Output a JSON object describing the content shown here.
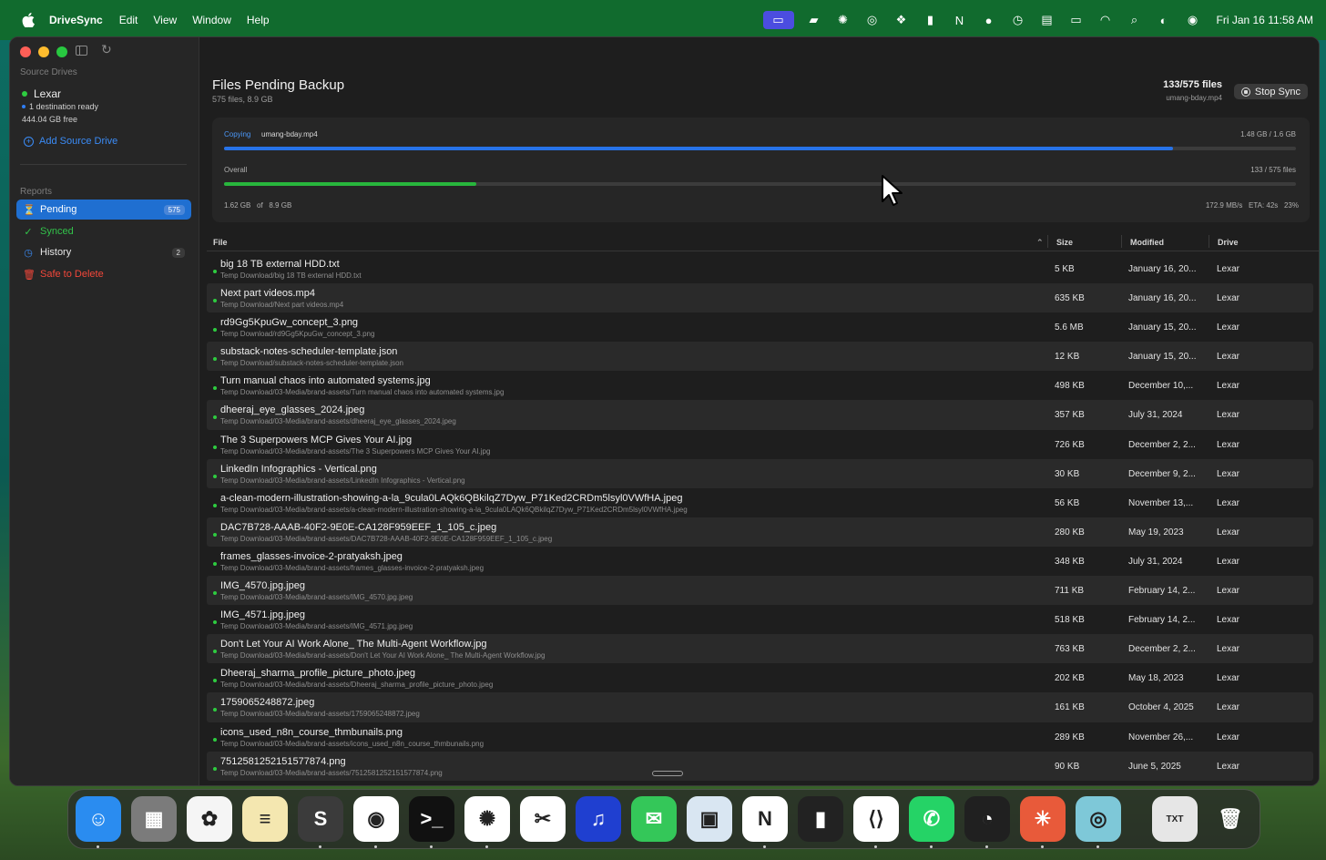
{
  "menubar": {
    "app_name": "DriveSync",
    "menus": [
      "Edit",
      "View",
      "Window",
      "Help"
    ],
    "status_icons": [
      "screen-share-icon",
      "car-icon",
      "sparkle-icon",
      "chatgpt-icon",
      "dropbox-icon",
      "bars-icon",
      "notion-icon",
      "vpn-icon",
      "time-machine-icon",
      "keyboard-icon",
      "battery-icon",
      "wifi-icon",
      "search-icon",
      "control-center-icon",
      "siri-icon"
    ],
    "clock": "Fri Jan 16  11:58 AM"
  },
  "sidebar": {
    "source_drives_heading": "Source Drives",
    "drive": {
      "name": "Lexar",
      "destination": "1 destination ready",
      "free": "444.04 GB free"
    },
    "add_source": "Add Source Drive",
    "reports_heading": "Reports",
    "items": [
      {
        "label": "Pending",
        "badge": "575",
        "icon": "pending-icon"
      },
      {
        "label": "Synced",
        "badge": "",
        "icon": "check-circle-icon"
      },
      {
        "label": "History",
        "badge": "2",
        "icon": "clock-icon"
      },
      {
        "label": "Safe to Delete",
        "badge": "",
        "icon": "trash-icon"
      }
    ]
  },
  "header": {
    "title": "Files Pending Backup",
    "subtitle": "575 files, 8.9 GB",
    "count": "133/575 files",
    "current_file": "umang-bday.mp4",
    "stop_label": "Stop Sync"
  },
  "progress": {
    "copying_label": "Copying",
    "copying_file": "umang-bday.mp4",
    "file_progress_text": "1.48 GB / 1.6 GB",
    "file_fraction": 0.885,
    "overall_label": "Overall",
    "overall_text": "133 / 575 files",
    "overall_fraction": 0.235,
    "copied": "1.62 GB",
    "of_label": "of",
    "total": "8.9 GB",
    "speed": "172.9 MB/s",
    "eta": "ETA: 42s",
    "percent": "23%"
  },
  "table": {
    "columns": {
      "file": "File",
      "size": "Size",
      "modified": "Modified",
      "drive": "Drive"
    },
    "rows": [
      {
        "name": "big 18 TB external HDD.txt",
        "path": "Temp Download/big 18 TB external HDD.txt",
        "size": "5 KB",
        "modified": "January 16, 20...",
        "drive": "Lexar"
      },
      {
        "name": "Next part videos.mp4",
        "path": "Temp Download/Next part videos.mp4",
        "size": "635 KB",
        "modified": "January 16, 20...",
        "drive": "Lexar"
      },
      {
        "name": "rd9Gg5KpuGw_concept_3.png",
        "path": "Temp Download/rd9Gg5KpuGw_concept_3.png",
        "size": "5.6 MB",
        "modified": "January 15, 20...",
        "drive": "Lexar"
      },
      {
        "name": "substack-notes-scheduler-template.json",
        "path": "Temp Download/substack-notes-scheduler-template.json",
        "size": "12 KB",
        "modified": "January 15, 20...",
        "drive": "Lexar"
      },
      {
        "name": "Turn manual chaos into automated systems.jpg",
        "path": "Temp Download/03-Media/brand-assets/Turn manual chaos into automated systems.jpg",
        "size": "498 KB",
        "modified": "December 10,...",
        "drive": "Lexar"
      },
      {
        "name": "dheeraj_eye_glasses_2024.jpeg",
        "path": "Temp Download/03-Media/brand-assets/dheeraj_eye_glasses_2024.jpeg",
        "size": "357 KB",
        "modified": "July 31, 2024",
        "drive": "Lexar"
      },
      {
        "name": "The 3 Superpowers MCP Gives Your AI.jpg",
        "path": "Temp Download/03-Media/brand-assets/The 3 Superpowers MCP Gives Your AI.jpg",
        "size": "726 KB",
        "modified": "December 2, 2...",
        "drive": "Lexar"
      },
      {
        "name": "LinkedIn Infographics - Vertical.png",
        "path": "Temp Download/03-Media/brand-assets/LinkedIn Infographics - Vertical.png",
        "size": "30 KB",
        "modified": "December 9, 2...",
        "drive": "Lexar"
      },
      {
        "name": "a-clean-modern-illustration-showing-a-la_9cula0LAQk6QBkilqZ7Dyw_P71Ked2CRDm5lsyl0VWfHA.jpeg",
        "path": "Temp Download/03-Media/brand-assets/a-clean-modern-illustration-showing-a-la_9cula0LAQk6QBkilqZ7Dyw_P71Ked2CRDm5lsyl0VWfHA.jpeg",
        "size": "56 KB",
        "modified": "November 13,...",
        "drive": "Lexar"
      },
      {
        "name": "DAC7B728-AAAB-40F2-9E0E-CA128F959EEF_1_105_c.jpeg",
        "path": "Temp Download/03-Media/brand-assets/DAC7B728-AAAB-40F2-9E0E-CA128F959EEF_1_105_c.jpeg",
        "size": "280 KB",
        "modified": "May 19, 2023",
        "drive": "Lexar"
      },
      {
        "name": "frames_glasses-invoice-2-pratyaksh.jpeg",
        "path": "Temp Download/03-Media/brand-assets/frames_glasses-invoice-2-pratyaksh.jpeg",
        "size": "348 KB",
        "modified": "July 31, 2024",
        "drive": "Lexar"
      },
      {
        "name": "IMG_4570.jpg.jpeg",
        "path": "Temp Download/03-Media/brand-assets/IMG_4570.jpg.jpeg",
        "size": "711 KB",
        "modified": "February 14, 2...",
        "drive": "Lexar"
      },
      {
        "name": "IMG_4571.jpg.jpeg",
        "path": "Temp Download/03-Media/brand-assets/IMG_4571.jpg.jpeg",
        "size": "518 KB",
        "modified": "February 14, 2...",
        "drive": "Lexar"
      },
      {
        "name": "Don't Let Your AI Work Alone_ The Multi-Agent Workflow.jpg",
        "path": "Temp Download/03-Media/brand-assets/Don't Let Your AI Work Alone_ The Multi-Agent Workflow.jpg",
        "size": "763 KB",
        "modified": "December 2, 2...",
        "drive": "Lexar"
      },
      {
        "name": "Dheeraj_sharma_profile_picture_photo.jpeg",
        "path": "Temp Download/03-Media/brand-assets/Dheeraj_sharma_profile_picture_photo.jpeg",
        "size": "202 KB",
        "modified": "May 18, 2023",
        "drive": "Lexar"
      },
      {
        "name": "1759065248872.jpeg",
        "path": "Temp Download/03-Media/brand-assets/1759065248872.jpeg",
        "size": "161 KB",
        "modified": "October 4, 2025",
        "drive": "Lexar"
      },
      {
        "name": "icons_used_n8n_course_thmbunails.png",
        "path": "Temp Download/03-Media/brand-assets/icons_used_n8n_course_thmbunails.png",
        "size": "289 KB",
        "modified": "November 26,...",
        "drive": "Lexar"
      },
      {
        "name": "7512581252151577874.png",
        "path": "Temp Download/03-Media/brand-assets/7512581252151577874.png",
        "size": "90 KB",
        "modified": "June 5, 2025",
        "drive": "Lexar"
      }
    ]
  },
  "dock": {
    "apps": [
      {
        "name": "finder-icon",
        "glyph": "☺",
        "bg": "#2a8cf0",
        "running": true
      },
      {
        "name": "launchpad-icon",
        "glyph": "▦",
        "bg": "#7b7b7b",
        "running": false
      },
      {
        "name": "photos-icon",
        "glyph": "✿",
        "bg": "#f5f5f5",
        "running": false
      },
      {
        "name": "notes-icon",
        "glyph": "≡",
        "bg": "#f4e7b0",
        "running": false
      },
      {
        "name": "sublime-text-icon",
        "glyph": "S",
        "bg": "#3b3b3b",
        "running": true
      },
      {
        "name": "chrome-icon",
        "glyph": "◉",
        "bg": "#ffffff",
        "running": true
      },
      {
        "name": "terminal-icon",
        "glyph": ">_",
        "bg": "#111111",
        "running": true
      },
      {
        "name": "chatgpt-icon",
        "glyph": "✺",
        "bg": "#ffffff",
        "running": true
      },
      {
        "name": "capcut-icon",
        "glyph": "✂",
        "bg": "#ffffff",
        "running": false
      },
      {
        "name": "audacity-icon",
        "glyph": "♫",
        "bg": "#1f3fd0",
        "running": false
      },
      {
        "name": "messages-icon",
        "glyph": "✉",
        "bg": "#34c759",
        "running": false
      },
      {
        "name": "preview-icon",
        "glyph": "▣",
        "bg": "#d9e6f2",
        "running": false
      },
      {
        "name": "notion-icon",
        "glyph": "N",
        "bg": "#ffffff",
        "running": true
      },
      {
        "name": "audio-bars-icon",
        "glyph": "▮",
        "bg": "#222222",
        "running": false
      },
      {
        "name": "vscode-icon",
        "glyph": "⟨⟩",
        "bg": "#ffffff",
        "running": true
      },
      {
        "name": "whatsapp-icon",
        "glyph": "✆",
        "bg": "#25d366",
        "running": true
      },
      {
        "name": "screen-recorder-icon",
        "glyph": "◔",
        "bg": "#202020",
        "running": true
      },
      {
        "name": "claude-icon",
        "glyph": "✳",
        "bg": "#e85a3a",
        "running": true
      },
      {
        "name": "drivesync-icon",
        "glyph": "◎",
        "bg": "#7ec8d8",
        "running": true
      },
      {
        "name": "txt-document-icon",
        "glyph": "TXT",
        "bg": "#e6e6e6",
        "running": false
      },
      {
        "name": "trash-icon",
        "glyph": "🗑",
        "bg": "transparent",
        "running": false
      }
    ]
  }
}
